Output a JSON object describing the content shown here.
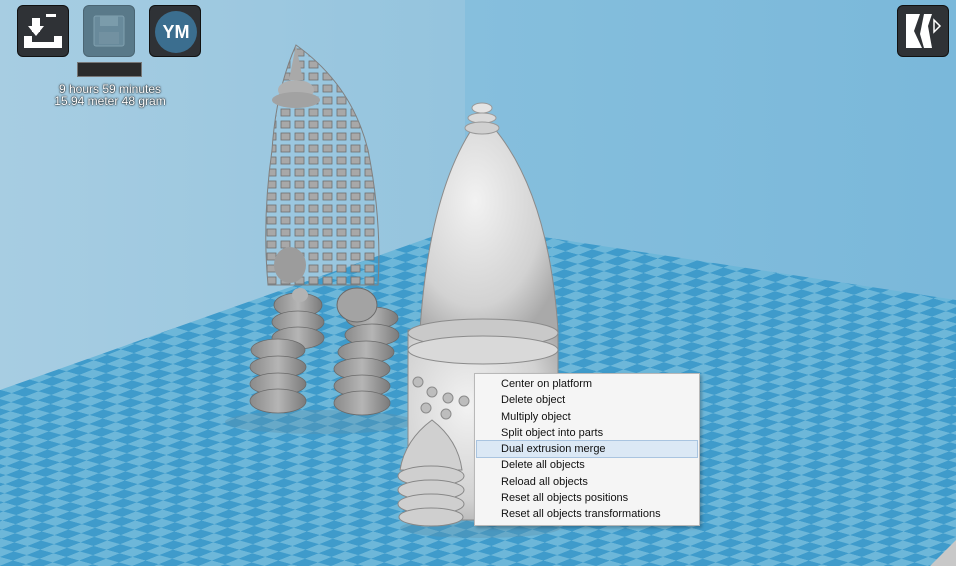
{
  "toolbar": {
    "load_icon": "load-model-icon",
    "save_icon": "save-disk-icon",
    "account_label": "YM",
    "view_icon": "view-mode-icon"
  },
  "print_info": {
    "time": "9 hours 59 minutes",
    "material": "15.94 meter 48 gram"
  },
  "context_menu": {
    "items": [
      {
        "label": "Center on platform",
        "highlighted": false
      },
      {
        "label": "Delete object",
        "highlighted": false
      },
      {
        "label": "Multiply object",
        "highlighted": false
      },
      {
        "label": "Split object into parts",
        "highlighted": false
      },
      {
        "label": "Dual extrusion merge",
        "highlighted": true
      },
      {
        "label": "Delete all objects",
        "highlighted": false
      },
      {
        "label": "Reload all objects",
        "highlighted": false
      },
      {
        "label": "Reset all objects positions",
        "highlighted": false
      },
      {
        "label": "Reset all objects transformations",
        "highlighted": false
      }
    ]
  },
  "colors": {
    "back_wall": "#8fc3df",
    "side_wall": "#a9cfe4",
    "floor_light": "#6cb6d8",
    "floor_dark": "#3f9ccc",
    "model": "#d6d6d6",
    "model_shadow": "#9a9a9a"
  }
}
